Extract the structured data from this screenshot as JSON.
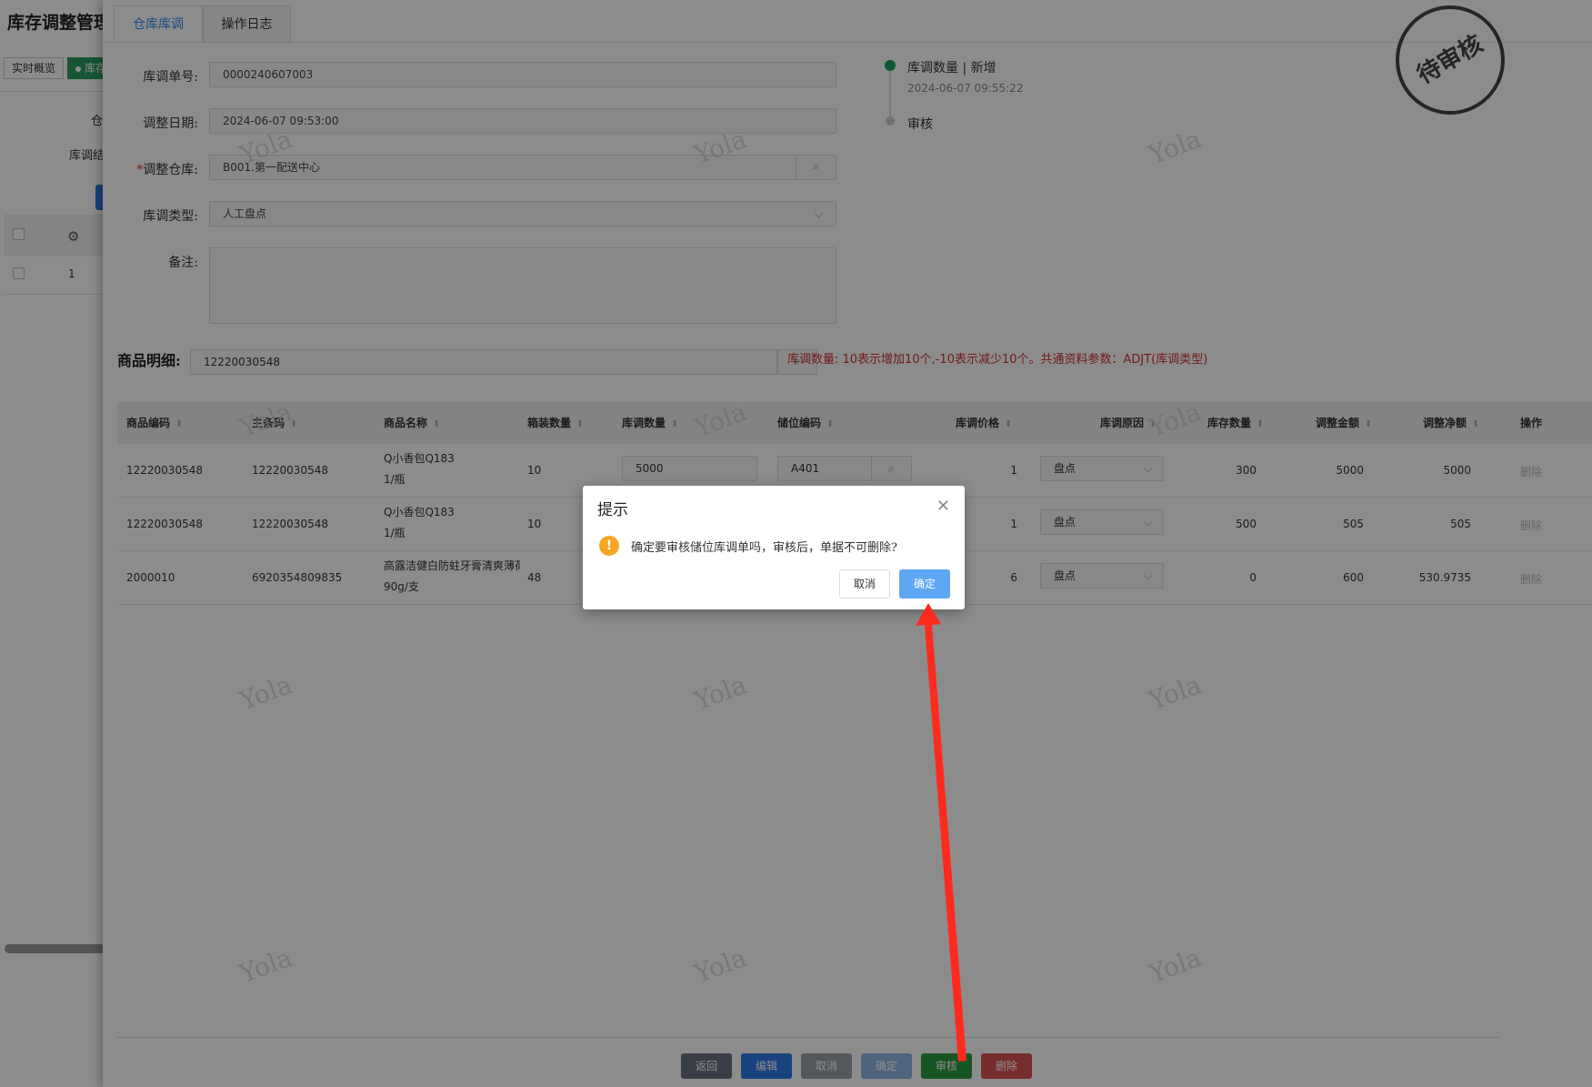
{
  "background": {
    "title": "库存调整管理",
    "tabs": [
      {
        "label": "实时概览"
      },
      {
        "label": "库存"
      }
    ],
    "label_warehouse_partial": "仓",
    "label_result_partial": "库调结",
    "row_number": "1"
  },
  "drawer": {
    "tabs": [
      {
        "label": "仓库库调"
      },
      {
        "label": "操作日志"
      }
    ],
    "form": {
      "order_no": {
        "label": "库调单号:",
        "value": "0000240607003"
      },
      "adjust_date": {
        "label": "调整日期:",
        "value": "2024-06-07 09:53:00"
      },
      "warehouse": {
        "required": "*",
        "label": "调整仓库:",
        "value": "B001.第一配送中心"
      },
      "adjust_type": {
        "label": "库调类型:",
        "value": "人工盘点"
      },
      "remark": {
        "label": "备注:",
        "value": ""
      }
    },
    "timeline": {
      "step1_title": "库调数量 | 新增",
      "step1_time": "2024-06-07 09:55:22",
      "step2_title": "审核"
    },
    "stamp": "待审核",
    "detail": {
      "label": "商品明细:",
      "search_value": "12220030548",
      "hint": "库调数量: 10表示增加10个,-10表示减少10个。共通资料参数：ADJT(库调类型)"
    },
    "grid": {
      "headers": [
        "商品编码",
        "主条码",
        "商品名称",
        "箱装数量",
        "库调数量",
        "储位编码",
        "库调价格",
        "库调原因",
        "库存数量",
        "调整金额",
        "调整净额",
        "操作"
      ],
      "rows": [
        {
          "code": "12220030548",
          "barcode": "12220030548",
          "name1": "Q小香包Q183",
          "name2": "1/瓶",
          "pack": "10",
          "qty": "5000",
          "loc": "A401",
          "price": "1",
          "reason": "盘点",
          "stock": "300",
          "amount": "5000",
          "net": "5000",
          "action": "删除"
        },
        {
          "code": "12220030548",
          "barcode": "12220030548",
          "name1": "Q小香包Q183",
          "name2": "1/瓶",
          "pack": "10",
          "qty": "",
          "loc": "",
          "price": "1",
          "reason": "盘点",
          "stock": "500",
          "amount": "505",
          "net": "505",
          "action": "删除"
        },
        {
          "code": "2000010",
          "barcode": "6920354809835",
          "name1": "高露洁健白防蛀牙膏清爽薄荷",
          "name2": "90g/支",
          "pack": "48",
          "qty": "",
          "loc": "",
          "price": "6",
          "reason": "盘点",
          "stock": "0",
          "amount": "600",
          "net": "530.9735",
          "action": "删除"
        }
      ]
    },
    "footer_buttons": [
      {
        "label": "返回",
        "color": "#6b7280"
      },
      {
        "label": "编辑",
        "color": "#2c7be5"
      },
      {
        "label": "取消",
        "color": "#9aa0a8"
      },
      {
        "label": "确定",
        "color": "#8fb6e8"
      },
      {
        "label": "审核",
        "color": "#2e9b3f"
      },
      {
        "label": "删除",
        "color": "#d9534f"
      }
    ],
    "watermark": "Yola"
  },
  "dialog": {
    "title": "提示",
    "message": "确定要审核储位库调单吗，审核后，单据不可删除?",
    "cancel": "取消",
    "ok": "确定"
  },
  "colors": {
    "accent": "#2d8cf0",
    "success": "#19a15f",
    "hint_red": "#d12e2e",
    "annotation_arrow": "#ff2a1f"
  }
}
